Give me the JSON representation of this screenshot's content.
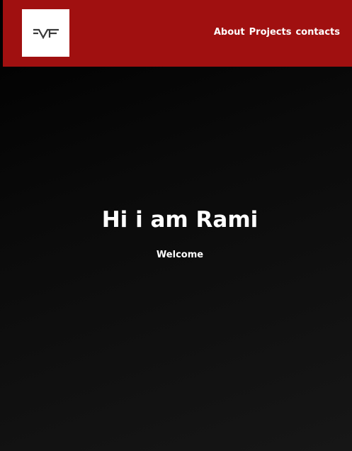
{
  "header": {
    "background_color": "#a01010",
    "logo_icon": "logo-mark-icon",
    "nav": [
      {
        "label": "About"
      },
      {
        "label": "Projects"
      },
      {
        "label": "contacts"
      }
    ]
  },
  "hero": {
    "title": "Hi i am Rami",
    "subtitle": "Welcome"
  }
}
